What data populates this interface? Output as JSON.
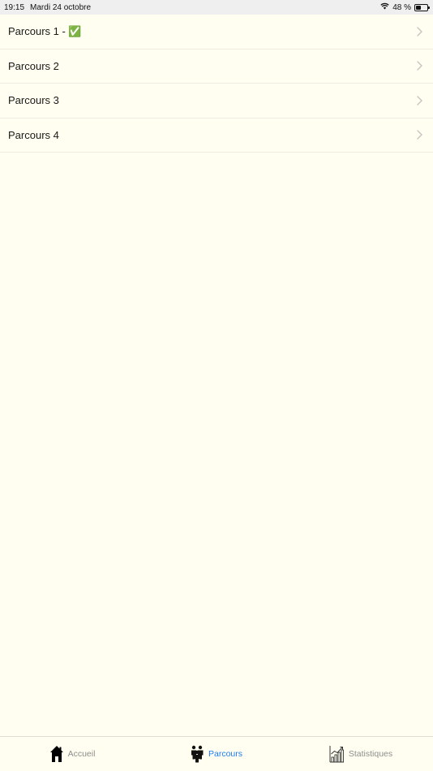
{
  "status_bar": {
    "time": "19:15",
    "date": "Mardi 24 octobre",
    "battery_text": "48 %",
    "battery_level": 0.48
  },
  "list": {
    "items": [
      {
        "label": "Parcours 1 - ✅"
      },
      {
        "label": "Parcours 2"
      },
      {
        "label": "Parcours 3"
      },
      {
        "label": "Parcours 4"
      }
    ]
  },
  "tab_bar": {
    "tabs": [
      {
        "label": "Accueil",
        "icon": "home-icon",
        "active": false
      },
      {
        "label": "Parcours",
        "icon": "people-icon",
        "active": true
      },
      {
        "label": "Statistiques",
        "icon": "chart-icon",
        "active": false
      }
    ],
    "active_color": "#1E7CF2",
    "inactive_color": "#8E8E8E"
  },
  "colors": {
    "background": "#FFFEF0",
    "status_bar": "#EFEFEF"
  }
}
